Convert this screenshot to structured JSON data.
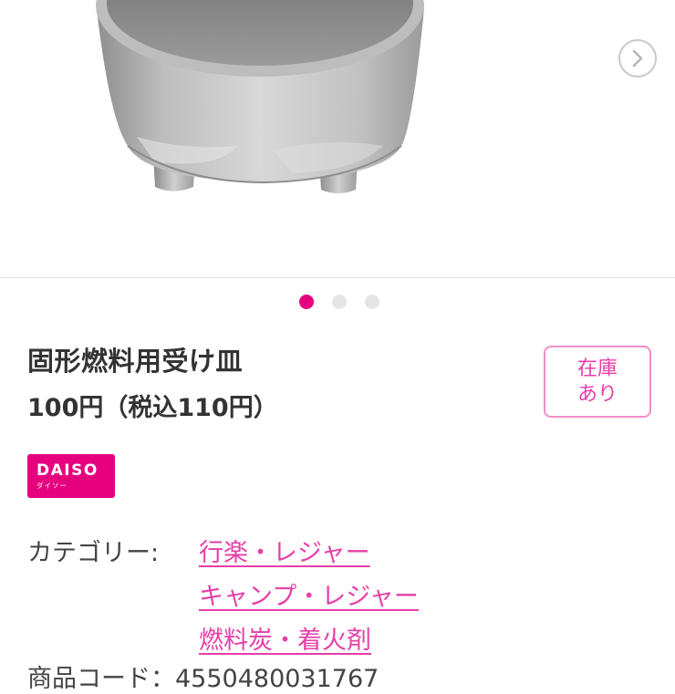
{
  "product": {
    "title": "固形燃料用受け皿",
    "price": "100円（税込110円）",
    "stock_line1": "在庫",
    "stock_line2": "あり",
    "brand_logo_text": "DAISO",
    "brand_logo_subtext": "ダイソー",
    "category_label": "カテゴリー:",
    "categories": [
      "行楽・レジャー",
      "キャンプ・レジャー",
      "燃料炭・着火剤"
    ],
    "code_line": "商品コード：4550480031767"
  },
  "gallery": {
    "slide_count": 3,
    "active_slide": 1,
    "image_icon": "metal-bowl-product-photo",
    "next_icon": "chevron-right-icon"
  },
  "colors": {
    "accent": "#e6007e",
    "link": "#e63fa8",
    "dot_active": "#e6007e",
    "dot_inactive": "#e5e5e5",
    "text": "#333333"
  }
}
